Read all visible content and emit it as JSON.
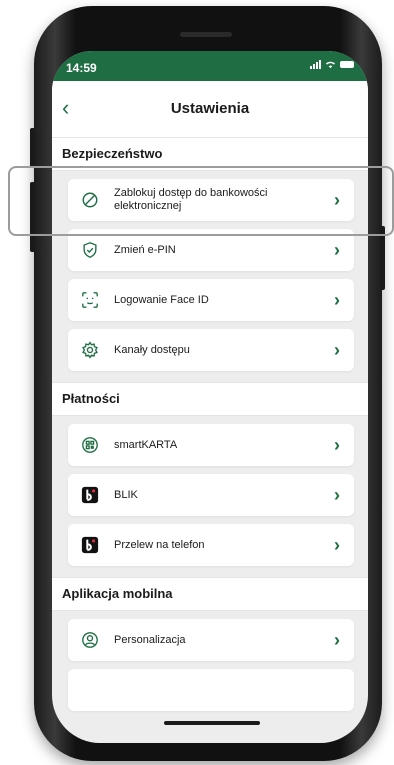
{
  "status_bar": {
    "time": "14:59"
  },
  "header": {
    "title": "Ustawienia"
  },
  "sections": [
    {
      "title": "Bezpieczeństwo",
      "items": [
        {
          "label": "Zablokuj dostęp do bankowości elektronicznej",
          "icon": "block-icon"
        },
        {
          "label": "Zmień e-PIN",
          "icon": "shield-check-icon"
        },
        {
          "label": "Logowanie Face ID",
          "icon": "face-id-icon"
        },
        {
          "label": "Kanały dostępu",
          "icon": "gear-icon"
        }
      ]
    },
    {
      "title": "Płatności",
      "items": [
        {
          "label": "smartKARTA",
          "icon": "qr-card-icon"
        },
        {
          "label": "BLIK",
          "icon": "blik-logo-icon"
        },
        {
          "label": "Przelew na telefon",
          "icon": "blik-logo-icon"
        }
      ]
    },
    {
      "title": "Aplikacja mobilna",
      "items": [
        {
          "label": "Personalizacja",
          "icon": "user-circle-icon"
        }
      ]
    }
  ],
  "colors": {
    "accent": "#1f6e43",
    "background": "#ededed",
    "card": "#ffffff"
  }
}
